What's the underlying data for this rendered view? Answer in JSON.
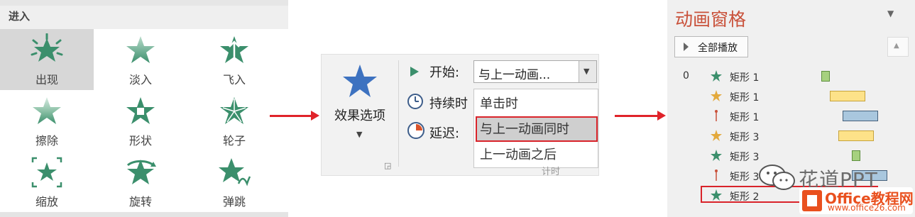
{
  "gallery": {
    "title": "进入",
    "effects": [
      {
        "label": "出现",
        "selected": true,
        "icon": "star-burst-icon"
      },
      {
        "label": "淡入",
        "selected": false,
        "icon": "star-fade-icon"
      },
      {
        "label": "飞入",
        "selected": false,
        "icon": "star-fly-in-icon"
      },
      {
        "label": "擦除",
        "selected": false,
        "icon": "star-wipe-icon"
      },
      {
        "label": "形状",
        "selected": false,
        "icon": "star-shape-icon"
      },
      {
        "label": "轮子",
        "selected": false,
        "icon": "star-wheel-icon"
      },
      {
        "label": "缩放",
        "selected": false,
        "icon": "star-zoom-icon"
      },
      {
        "label": "旋转",
        "selected": false,
        "icon": "star-rotate-icon"
      },
      {
        "label": "弹跳",
        "selected": false,
        "icon": "star-bounce-icon"
      }
    ]
  },
  "ribbon": {
    "effect_options_label": "效果选项",
    "start_label": "开始:",
    "start_value": "与上一动画...",
    "duration_label": "持续时",
    "delay_label": "延迟:",
    "start_options": [
      "单击时",
      "与上一动画同时",
      "上一动画之后"
    ],
    "selected_option": "与上一动画同时",
    "group_label_fragment": "计时"
  },
  "pane": {
    "title": "动画窗格",
    "play_all_label": "全部播放",
    "items": [
      {
        "num": "0",
        "name": "矩形 1",
        "icon": "green-star-icon",
        "bar_color": "#a6d17f"
      },
      {
        "num": "",
        "name": "矩形 1",
        "icon": "gold-star-icon",
        "bar_color": "#fde289"
      },
      {
        "num": "",
        "name": "矩形 1",
        "icon": "motion-path-icon",
        "bar_color": "#a9c7de"
      },
      {
        "num": "",
        "name": "矩形 3",
        "icon": "gold-star-icon",
        "bar_color": "#fde289"
      },
      {
        "num": "",
        "name": "矩形 3",
        "icon": "green-star-icon",
        "bar_color": "#a6d17f"
      },
      {
        "num": "",
        "name": "矩形 3",
        "icon": "motion-path-icon",
        "bar_color": "#a9c7de"
      },
      {
        "num": "",
        "name": "矩形 2",
        "icon": "green-star-icon",
        "bar_color": "#a6d17f"
      }
    ]
  },
  "watermark": {
    "text": "花道PPT",
    "brand": "Office教程网",
    "url": "www.office26.com"
  },
  "colors": {
    "accent_red": "#e0232a",
    "pane_title": "#c9513a",
    "star_green": "#3b8f6c",
    "star_blue": "#3d72c0"
  }
}
